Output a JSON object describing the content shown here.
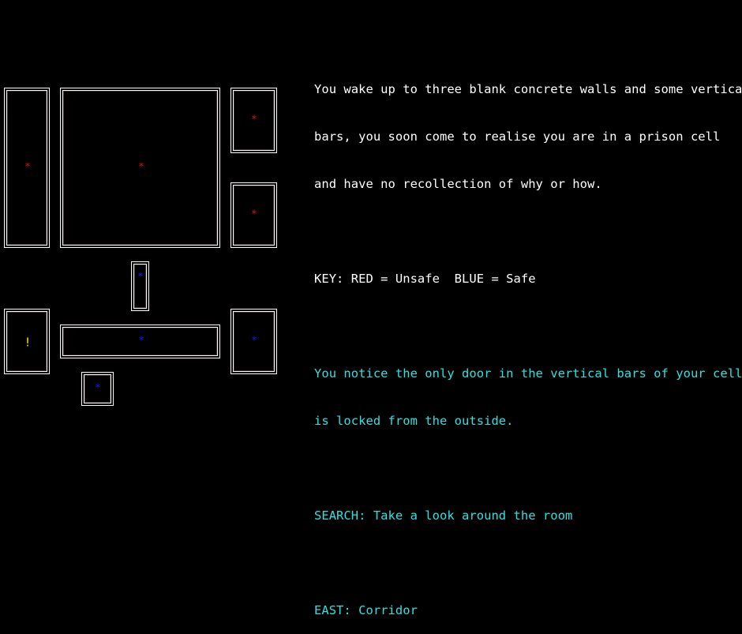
{
  "map": {
    "colors": {
      "background": "#000000",
      "room_border": "#ffffff",
      "unsafe": "#e01010",
      "safe": "#1a1aff",
      "alert": "#f0e020"
    },
    "rooms": [
      {
        "id": "left-tall",
        "marker": "*",
        "status": "unsafe"
      },
      {
        "id": "big-center",
        "marker": "*",
        "status": "unsafe"
      },
      {
        "id": "right-top",
        "marker": "*",
        "status": "unsafe"
      },
      {
        "id": "right-middle",
        "marker": "*",
        "status": "unsafe"
      },
      {
        "id": "small-connector",
        "marker": "*",
        "status": "safe"
      },
      {
        "id": "left-bottom",
        "marker": "!",
        "status": "alert"
      },
      {
        "id": "long-corridor",
        "marker": "*",
        "status": "safe"
      },
      {
        "id": "right-bottom",
        "marker": "*",
        "status": "safe"
      },
      {
        "id": "small-bottom",
        "marker": "*",
        "status": "safe"
      }
    ]
  },
  "narrative": {
    "intro": [
      "You wake up to three blank concrete walls and some vertical",
      "bars, you soon come to realise you are in a prison cell",
      "and have no recollection of why or how."
    ],
    "key": "KEY: RED = Unsafe  BLUE = Safe",
    "notice": [
      "You notice the only door in the vertical bars of your cell",
      "is locked from the outside."
    ],
    "options": {
      "search": "SEARCH: Take a look around the room",
      "east": "EAST: Corridor"
    }
  }
}
